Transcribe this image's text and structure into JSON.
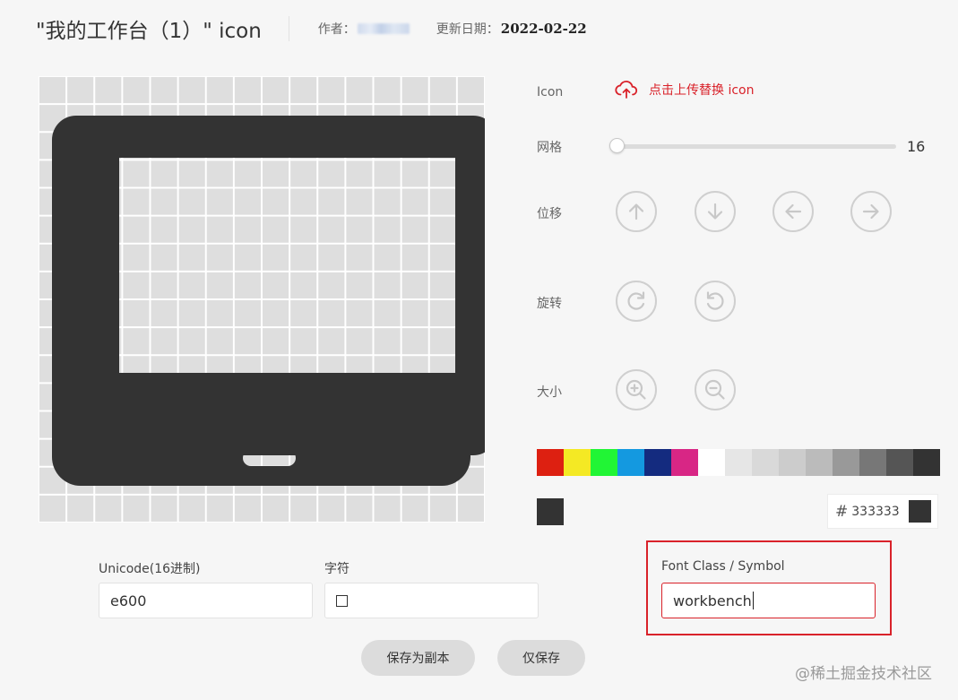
{
  "header": {
    "title": "\"我的工作台（1）\" icon",
    "author_label": "作者：",
    "date_label": "更新日期：",
    "date_value": "2022-02-22"
  },
  "controls": {
    "icon_label": "Icon",
    "upload_text": "点击上传替换 icon",
    "grid_label": "网格",
    "grid_value": "16",
    "grid_slider_fraction": 0,
    "move_label": "位移",
    "rotate_label": "旋转",
    "size_label": "大小"
  },
  "colors": {
    "palette": [
      "#dd2011",
      "#f4e924",
      "#21f535",
      "#1499e0",
      "#142b7f",
      "#d82685",
      "#ffffff",
      "#e6e6e6",
      "#d9d9d9",
      "#cccccc",
      "#bbbbbb",
      "#999999",
      "#777777",
      "#555555",
      "#333333"
    ],
    "current": "#333333",
    "hash": "#",
    "hex_value": "333333",
    "accent": "#d9222a"
  },
  "fields": {
    "unicode_label": "Unicode(16进制)",
    "unicode_value": "e600",
    "char_label": "字符",
    "fontclass_label": "Font Class / Symbol",
    "fontclass_value": "workbench"
  },
  "buttons": {
    "save_copy": "保存为副本",
    "save_only": "仅保存"
  },
  "icons": {
    "preview": "laptop-icon",
    "upload": "cloud-upload-icon",
    "move": [
      "arrow-up-icon",
      "arrow-down-icon",
      "arrow-left-icon",
      "arrow-right-icon"
    ],
    "rotate": [
      "rotate-clockwise-icon",
      "rotate-counterclockwise-icon"
    ],
    "size": [
      "zoom-in-icon",
      "zoom-out-icon"
    ]
  },
  "watermark": "@稀土掘金技术社区"
}
